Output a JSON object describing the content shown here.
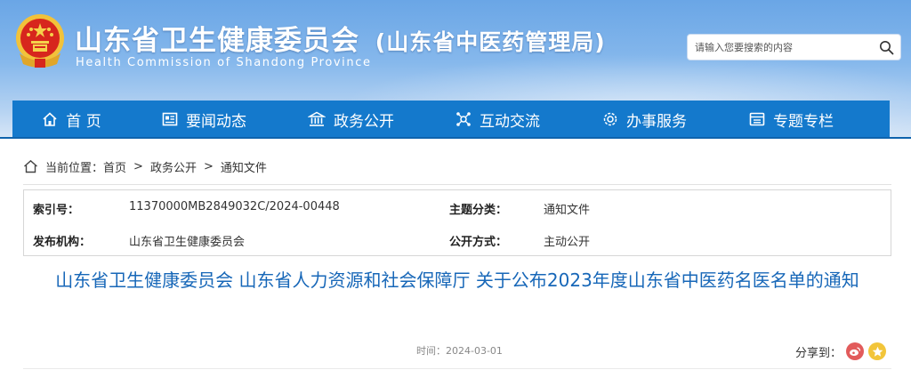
{
  "header": {
    "title": "山东省卫生健康委员会",
    "subtitle": "(山东省中医药管理局)",
    "english": "Health Commission of Shandong Province",
    "emblem_icon": "national-emblem-icon"
  },
  "search": {
    "placeholder": "请输入您要搜索的内容",
    "icon": "search-icon"
  },
  "nav": {
    "items": [
      {
        "label": "首 页",
        "icon": "home-icon"
      },
      {
        "label": "要闻动态",
        "icon": "news-icon"
      },
      {
        "label": "政务公开",
        "icon": "government-icon"
      },
      {
        "label": "互动交流",
        "icon": "interaction-icon"
      },
      {
        "label": "办事服务",
        "icon": "service-icon"
      },
      {
        "label": "专题专栏",
        "icon": "topic-icon"
      }
    ],
    "background": "#1479cc"
  },
  "breadcrumb": {
    "prefix": "当前位置：",
    "items": [
      "首页",
      "政务公开",
      "通知文件"
    ],
    "separator": ">"
  },
  "meta": {
    "index_label": "索引号：",
    "index_value": "11370000MB2849032C/2024-00448",
    "topic_label": "主题分类：",
    "topic_value": "通知文件",
    "publisher_label": "发布机构：",
    "publisher_value": "山东省卫生健康委员会",
    "open_label": "公开方式：",
    "open_value": "主动公开"
  },
  "article": {
    "title": "山东省卫生健康委员会 山东省人力资源和社会保障厅 关于公布2023年度山东省中医药名医名单的通知",
    "date": "时间：2024-03-01"
  },
  "share": {
    "label": "分享到：",
    "icons": [
      "weibo-icon",
      "qzone-icon"
    ]
  }
}
